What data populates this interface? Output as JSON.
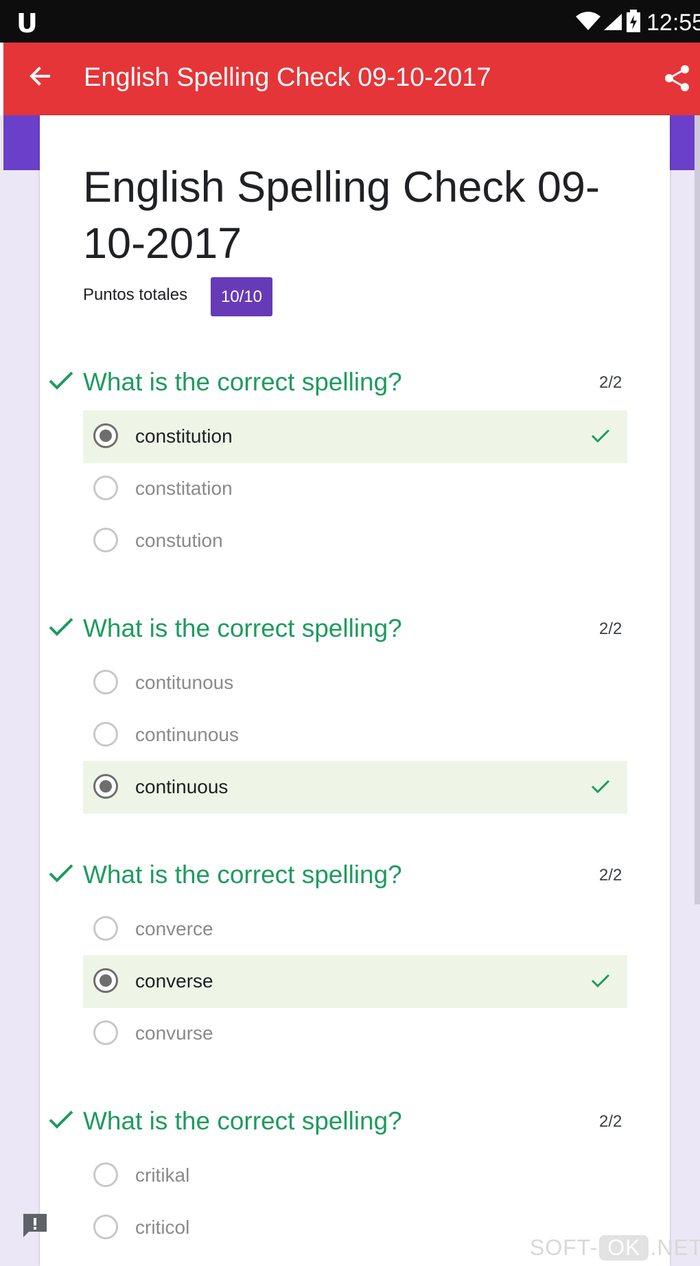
{
  "status_bar": {
    "carrier_icon": "U",
    "time": "12:55",
    "icons": [
      "wifi-icon",
      "signal-icon",
      "battery-icon"
    ]
  },
  "app_bar": {
    "title": "English Spelling Check 09-10-2017",
    "back_icon": "arrow-left-icon",
    "share_icon": "share-icon",
    "color": "#e53538"
  },
  "form": {
    "title": "English Spelling Check 09-10-2017",
    "points_label": "Puntos totales",
    "points_value": "10/10",
    "accent_color": "#673ab7"
  },
  "questions": [
    {
      "title": "What is the correct spelling?",
      "score": "2/2",
      "options": [
        {
          "label": "constitution",
          "selected": true,
          "correct": true
        },
        {
          "label": "constitation",
          "selected": false,
          "correct": false
        },
        {
          "label": "constution",
          "selected": false,
          "correct": false
        }
      ]
    },
    {
      "title": "What is the correct spelling?",
      "score": "2/2",
      "options": [
        {
          "label": "contitunous",
          "selected": false,
          "correct": false
        },
        {
          "label": "continunous",
          "selected": false,
          "correct": false
        },
        {
          "label": "continuous",
          "selected": true,
          "correct": true
        }
      ]
    },
    {
      "title": "What is the correct spelling?",
      "score": "2/2",
      "options": [
        {
          "label": "converce",
          "selected": false,
          "correct": false
        },
        {
          "label": "converse",
          "selected": true,
          "correct": true
        },
        {
          "label": "convurse",
          "selected": false,
          "correct": false
        }
      ]
    },
    {
      "title": "What is the correct spelling?",
      "score": "2/2",
      "options": [
        {
          "label": "critikal",
          "selected": false,
          "correct": false
        },
        {
          "label": "criticol",
          "selected": false,
          "correct": false
        }
      ]
    }
  ],
  "watermark": {
    "prefix": "SOFT-",
    "mid": "OK",
    "suffix": ".NET"
  },
  "colors": {
    "correct_green": "#1e9b5f",
    "correct_bg": "#eef5e6"
  }
}
